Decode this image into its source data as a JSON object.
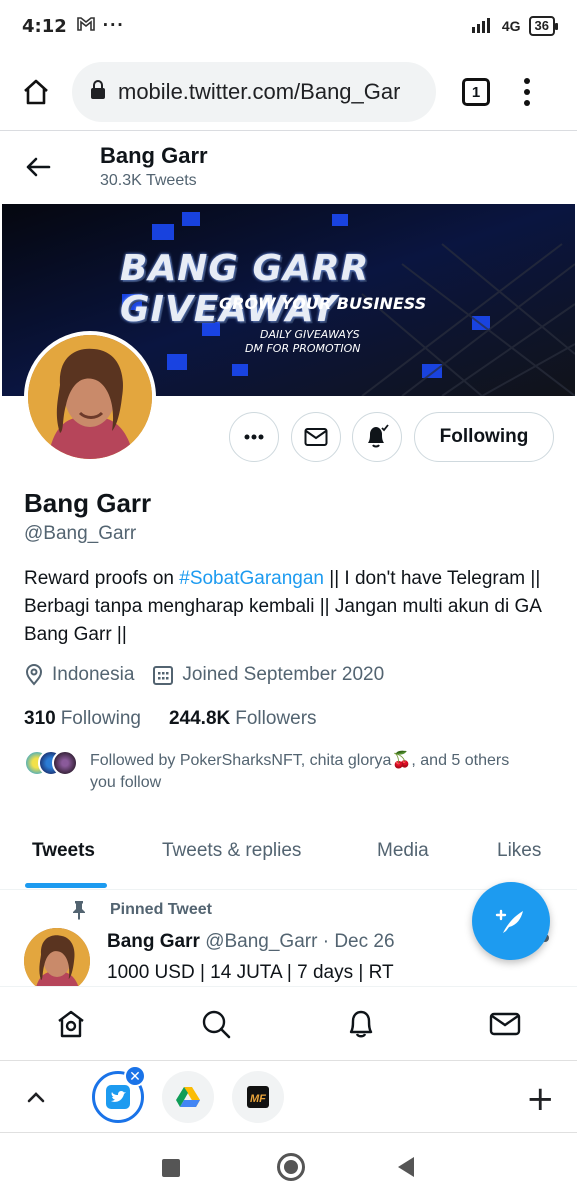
{
  "status_bar": {
    "time": "4:12",
    "network": "4G",
    "battery": "36"
  },
  "browser": {
    "url": "mobile.twitter.com/Bang_Gar",
    "tab_count": "1"
  },
  "header": {
    "name": "Bang Garr",
    "tweet_count": "30.3K Tweets"
  },
  "banner": {
    "title": "BANG GARR GIVEAWAY",
    "subtitle": "GROW YOUR BUSINESS",
    "line1": "DAILY GIVEAWAYS",
    "line2": "DM FOR PROMOTION"
  },
  "profile": {
    "follow_button": "Following",
    "name": "Bang Garr",
    "handle": "@Bang_Garr",
    "bio_prefix": "Reward proofs on ",
    "bio_hashtag": "#SobatGarangan",
    "bio_suffix": " || I don't have Telegram || Berbagi tanpa mengharap kembali || Jangan multi akun di GA Bang Garr ||",
    "location": "Indonesia",
    "joined": "Joined September 2020",
    "following_count": "310",
    "following_label": "Following",
    "followers_count": "244.8K",
    "followers_label": "Followers",
    "followed_by_text": "Followed by PokerSharksNFT, chita glorya🍒, and 5 others you follow"
  },
  "tabs": [
    {
      "label": "Tweets",
      "active": true
    },
    {
      "label": "Tweets & replies",
      "active": false
    },
    {
      "label": "Media",
      "active": false
    },
    {
      "label": "Likes",
      "active": false
    }
  ],
  "pinned_tweet": {
    "pinned_label": "Pinned Tweet",
    "author": "Bang Garr",
    "handle_date": "@Bang_Garr · Dec 26",
    "text": "1000 USD | 14 JUTA | 7 days | RT"
  },
  "colors": {
    "accent": "#1d9bf0",
    "chrome_blue": "#1a73e8",
    "secondary_text": "#536471"
  }
}
